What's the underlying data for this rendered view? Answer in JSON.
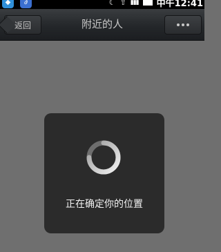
{
  "statusbar": {
    "clock": "中午12:41",
    "icons": [
      "app-icon",
      "clip-icon",
      "moon-icon",
      "wifi-icon",
      "signal-icon",
      "battery-icon"
    ]
  },
  "titlebar": {
    "back_label": "返回",
    "title": "附近的人",
    "more_icon": "more-dots-icon"
  },
  "loading": {
    "message": "正在确定你的位置",
    "icon": "spinner-icon"
  },
  "colors": {
    "background": "#6f6f6f",
    "titlebar": "#24272a",
    "card": "#2b2b2b"
  }
}
